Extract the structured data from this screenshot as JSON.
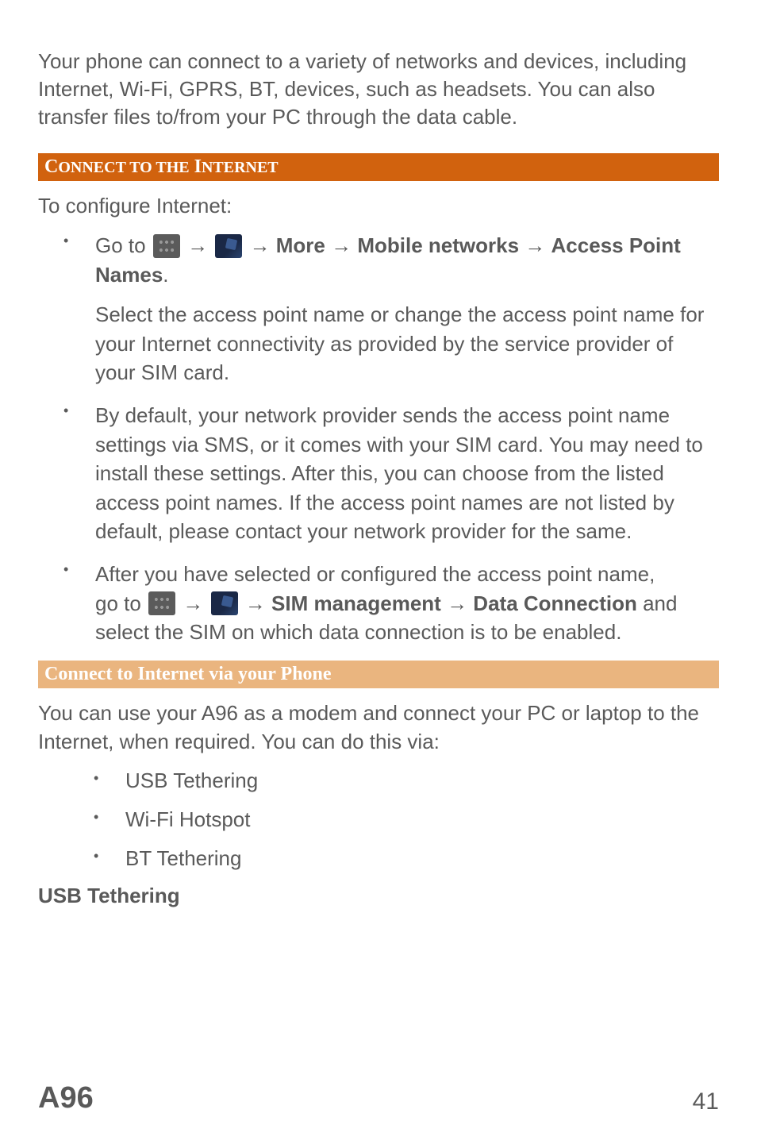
{
  "intro": "Your phone can connect to a variety of networks and devices, including Internet, Wi-Fi, GPRS, BT, devices, such as headsets. You can also transfer files to/from your PC through the data cable.",
  "section_header": {
    "word1_first": "C",
    "word1_rest": "ONNECT TO THE",
    "word2_first": "I",
    "word2_rest": "NTERNET"
  },
  "configure_text": "To configure Internet:",
  "bullet1": {
    "prefix": "Go to ",
    "arrow": "→",
    "path_more": "More",
    "path_mobile": "Mobile networks",
    "path_apn": "Access Point Names",
    "period": ".",
    "sub": "Select the access point name or change the access point name for your Internet connectivity as provided by the service provider of your SIM card."
  },
  "bullet2": "By default, your network provider sends the access point name settings via SMS, or it comes with your SIM card. You may need to install these settings. After this, you can choose from the listed access point names. If the access point names are not listed by default, please contact your network provider for the same.",
  "bullet3": {
    "line1": "After you have selected or configured the access point name,",
    "prefix2": "go to ",
    "arrow": "→",
    "sim_mgmt": "SIM management",
    "data": "Data Connection",
    "tail": " and select the SIM on which data connection is to be enabled."
  },
  "subsection_header": "Connect to Internet via your Phone",
  "modem_text": "You can use your A96 as a modem and connect your PC or laptop to the Internet, when required. You can do this via:",
  "methods": {
    "usb": "USB Tethering",
    "wifi": "Wi-Fi Hotspot",
    "bt": "BT Tethering"
  },
  "usb_heading": "USB Tethering",
  "footer": {
    "model": "A96",
    "page": "41"
  }
}
